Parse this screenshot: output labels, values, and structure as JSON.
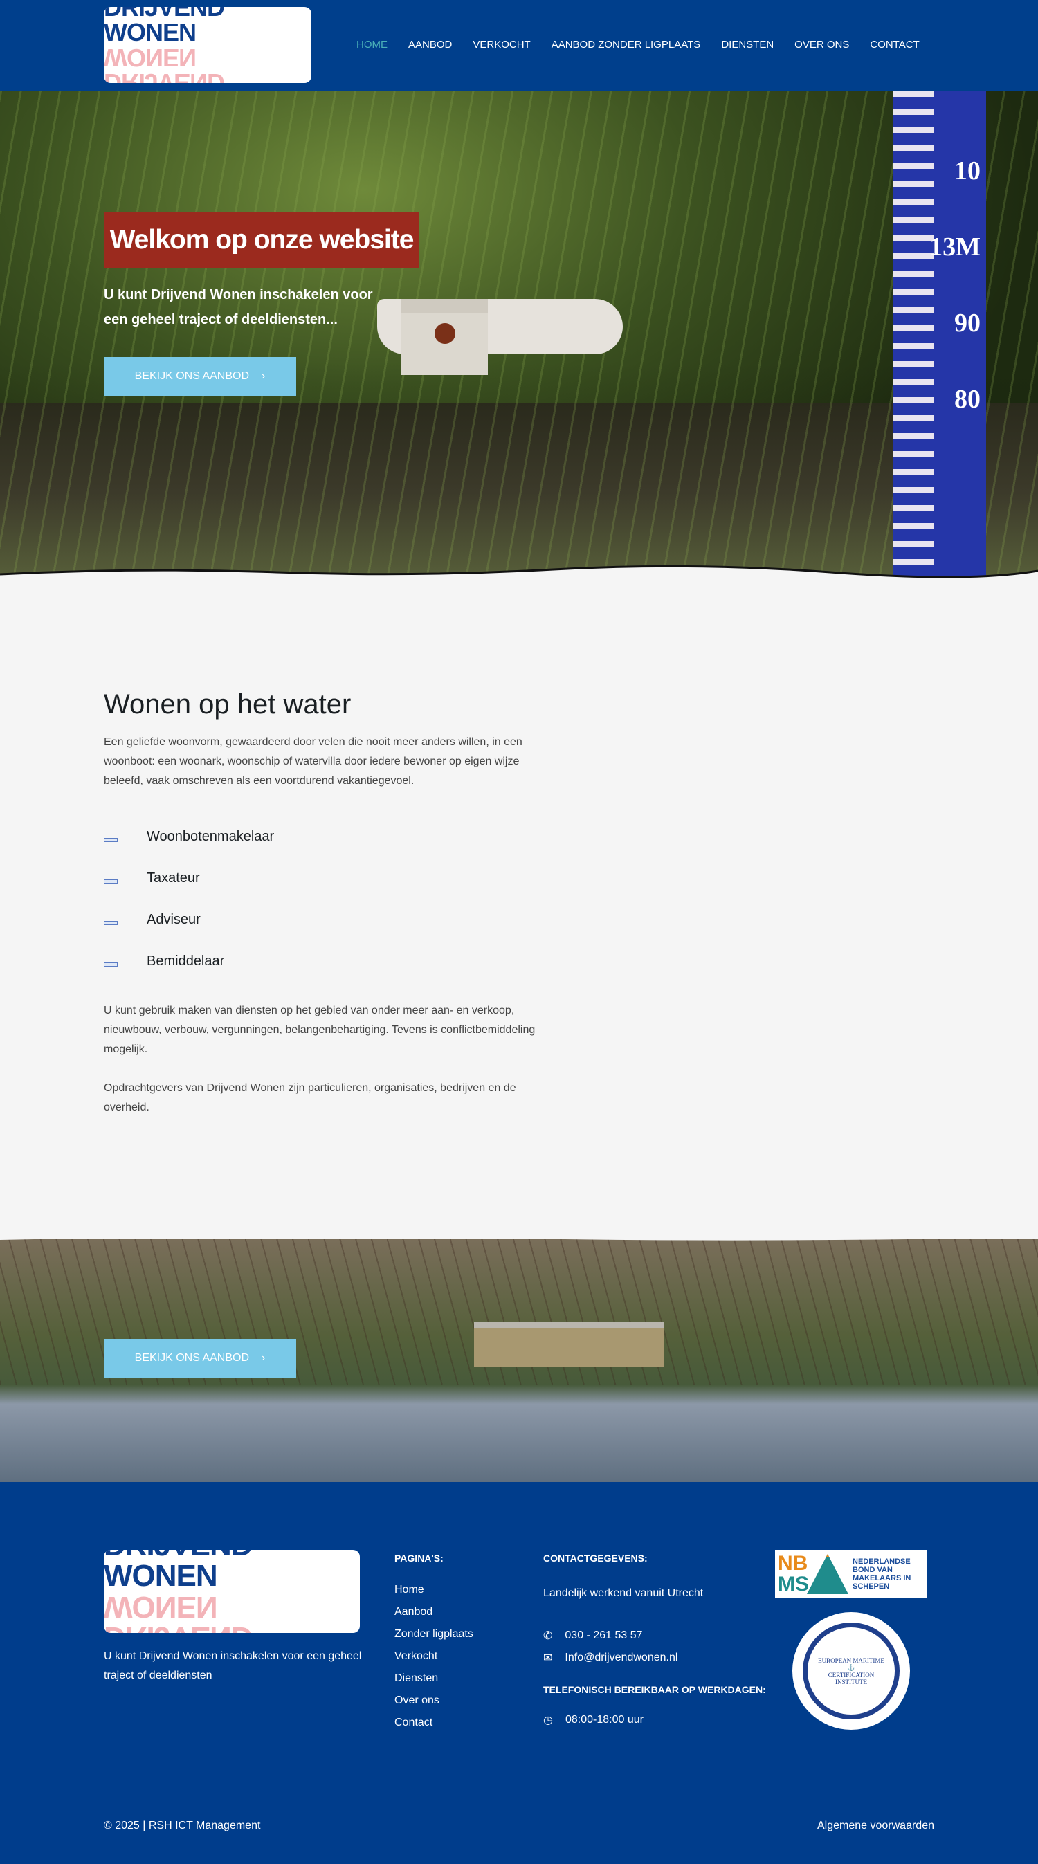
{
  "brand": {
    "logo_top": "DRIJVEND WONEN",
    "logo_bottom": "DRIJVEND WONEN"
  },
  "nav": [
    {
      "label": "HOME",
      "active": true
    },
    {
      "label": "AANBOD"
    },
    {
      "label": "VERKOCHT"
    },
    {
      "label": "AANBOD ZONDER LIGPLAATS"
    },
    {
      "label": "DIENSTEN"
    },
    {
      "label": "OVER ONS"
    },
    {
      "label": "CONTACT"
    }
  ],
  "hero": {
    "title": "Welkom op onze website",
    "subtitle": "U kunt Drijvend Wonen inschakelen voor een geheel traject of deeldiensten...",
    "button": "BEKIJK ONS AANBOD",
    "gauge_labels": [
      "10",
      "13M",
      "90",
      "80"
    ]
  },
  "content": {
    "heading": "Wonen op het water",
    "intro": "Een geliefde woonvorm, gewaardeerd door velen die nooit meer anders willen, in een woonboot: een woonark, woonschip of watervilla door iedere bewoner op eigen wijze beleefd, vaak omschreven als een voortdurend vakantiegevoel.",
    "items": [
      "Woonbotenmakelaar",
      "Taxateur",
      "Adviseur",
      "Bemiddelaar"
    ],
    "p2": "U kunt gebruik maken van diensten op het gebied van onder meer aan- en verkoop, nieuwbouw, verbouw, vergunningen, belangenbehartiging. Tevens is conflictbemiddeling mogelijk.",
    "p3": "Opdrachtgevers van Drijvend Wonen zijn particulieren, organisaties, bedrijven en de overheid."
  },
  "banner": {
    "button": "BEKIJK ONS AANBOD"
  },
  "footer": {
    "description": "U kunt Drijvend Wonen inschakelen voor een geheel traject of deeldiensten",
    "pages_title": "PAGINA'S:",
    "pages": [
      "Home",
      "Aanbod",
      "Zonder ligplaats",
      "Verkocht",
      "Diensten",
      "Over ons",
      "Contact"
    ],
    "contact_title": "CONTACTGEGEVENS:",
    "location": "Landelijk werkend vanuit Utrecht",
    "phone": "030 - 261 53 57",
    "email": "Info@drijvendwonen.nl",
    "hours_title": "TELEFONISCH BEREIKBAAR OP WERKDAGEN:",
    "hours": "08:00-18:00 uur",
    "nbms_logo": "NB MS NEDERLANDSE BOND VAN MAKELAARS IN SCHEPEN",
    "emci_logo": "EUROPEAN MARITIME CERTIFICATION INSTITUTE",
    "copyright": "© 2025 | RSH ICT Management",
    "terms": "Algemene voorwaarden"
  },
  "colors": {
    "header": "#003f8c",
    "hero_title_bg": "#9b2a1e",
    "button": "#79c9e8",
    "nav_active": "#4ab0b8"
  }
}
